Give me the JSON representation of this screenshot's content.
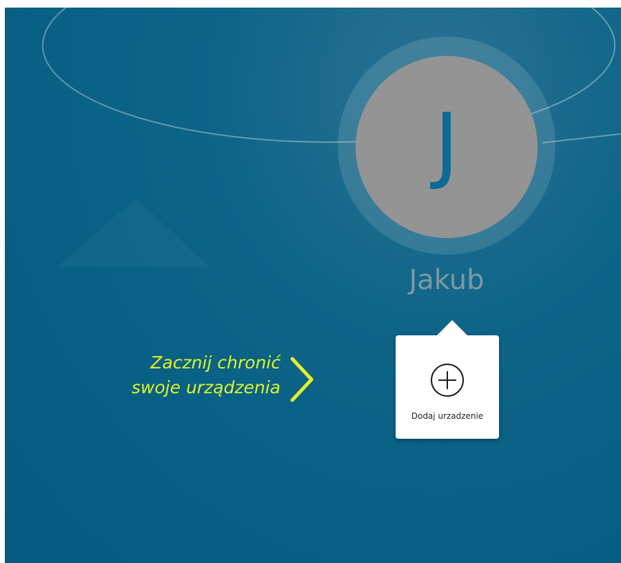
{
  "profile": {
    "initial": "J",
    "name": "Jakub"
  },
  "promo": {
    "line1": "Zacznij chronić",
    "line2": "swoje urządzenia",
    "arrow_icon": "chevron-right-icon",
    "color": "#dff22a"
  },
  "add_device": {
    "label": "Dodaj urzadzenie",
    "icon": "plus-circle-icon"
  },
  "colors": {
    "background": "#075f84",
    "avatar": "#949494",
    "initial": "#0d6a92",
    "username": "#7d98a6"
  }
}
